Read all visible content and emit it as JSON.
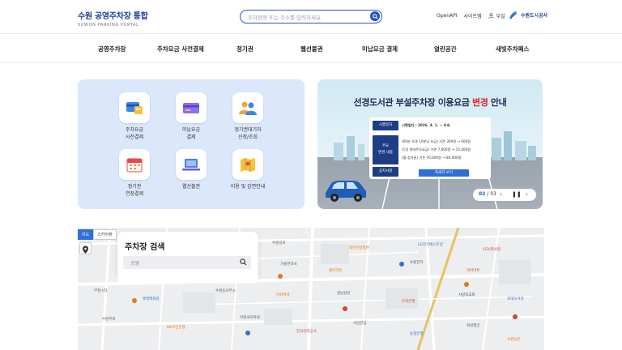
{
  "header": {
    "title": "수원 공영주차장 통합",
    "subtitle": "SUWON PARKING PORTAL",
    "search_placeholder": "주차장명 또는 주소를 입력하세요.",
    "utils": [
      "OpenAPI",
      "사이트맵"
    ],
    "login": "부설",
    "brand": "수원도시공사"
  },
  "nav": [
    "공영주차장",
    "주차요금 사전결제",
    "정기권",
    "웹선불권",
    "미납요금 결제",
    "열린공간",
    "새빛주차패스"
  ],
  "quick": [
    {
      "label": "주차요금\n사전결제"
    },
    {
      "label": "미납요금\n결제"
    },
    {
      "label": "정기권대기자\n신청/조회"
    },
    {
      "label": "정기권\n연장결제"
    },
    {
      "label": "웹선불권"
    },
    {
      "label": "이용 및 감면안내"
    }
  ],
  "banner": {
    "title_a": "선경도서관 부설주차장 이용요금 ",
    "title_hl": "변경",
    "title_b": " 안내",
    "rows": [
      {
        "head": "시행일자",
        "value": "시행일자 : 2026. 4. 1. ~ 지속"
      },
      {
        "head": "주요\n변경 내용",
        "value1": "(60분 초과 10분당 요금) 기존 300원 → 600원",
        "value2": "(1일 최대주차요금) 기존 7,000원 → 15,000원",
        "value3": "(월 정기권) 기존 70,000원 → 80,000원"
      },
      {
        "head": "공지사항",
        "value": "자세히 보기"
      }
    ],
    "pager_current": "02",
    "pager_total": "03"
  },
  "map": {
    "tabs": [
      "지도",
      "스카이뷰"
    ],
    "panel_title": "주차장 검색",
    "panel_placeholder": "공영",
    "labels": [
      "수원일보",
      "태민한방병원",
      "LG전자베스트샵",
      "CGV화성점",
      "가을한약국",
      "셀트리온",
      "수원전자",
      "하이마트",
      "부천스타",
      "롯데백화점",
      "수원동사무소",
      "이화여대",
      "정남성당",
      "우리은행",
      "사랑의교회",
      "로데오거리",
      "수원무리",
      "KB국민은행",
      "이영국어학원",
      "한국전력공사",
      "국민연금",
      "농협은행",
      "화성행궁",
      "수원남문"
    ]
  },
  "colors": {
    "primary": "#1e3f9a",
    "accent": "#2f55c8",
    "panel": "#dbe7fb",
    "red": "#e0282e"
  }
}
